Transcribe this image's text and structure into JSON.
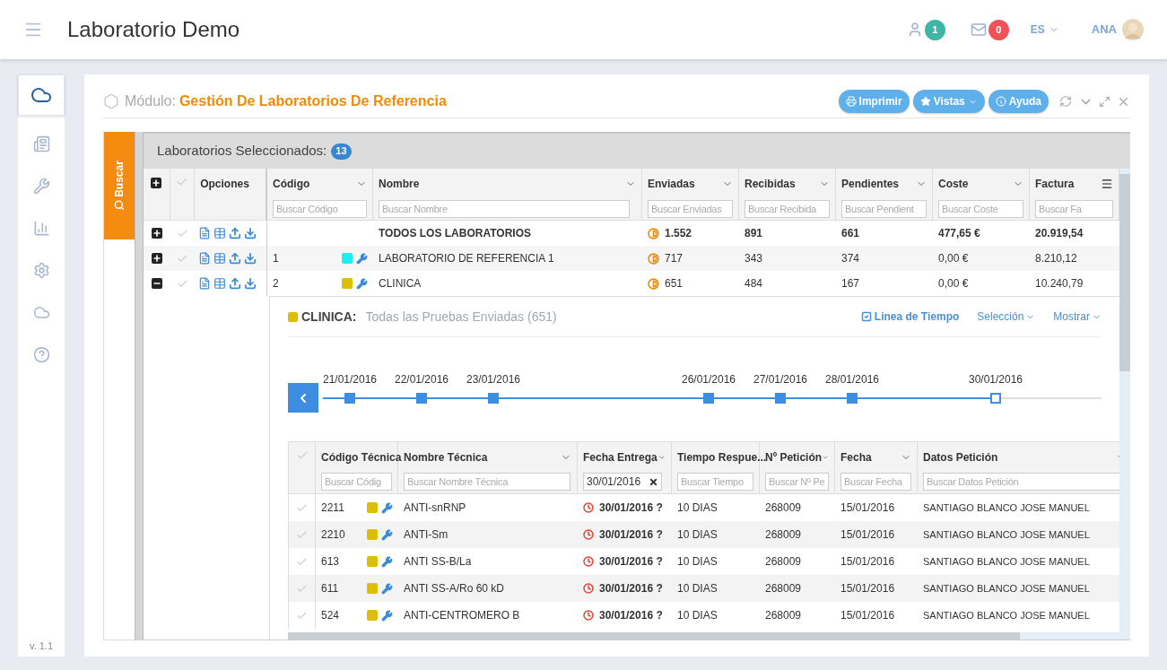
{
  "topbar": {
    "app_title": "Laboratorio Demo",
    "users_badge": "1",
    "messages_badge": "0",
    "language": "ES",
    "user": "ANA"
  },
  "sidebar": {
    "items": [
      {
        "selected": true
      },
      {
        "selected": false
      },
      {
        "selected": false
      },
      {
        "selected": false
      },
      {
        "selected": false
      },
      {
        "selected": false
      },
      {
        "selected": false
      }
    ],
    "version": "v. 1.1"
  },
  "module": {
    "label": "Módulo:",
    "title": "Gestión De Laboratorios De Referencia",
    "buttons": [
      "Imprimir",
      "Vistas",
      "Ayuda"
    ]
  },
  "search_tab": "Buscar",
  "labs": {
    "title": "Laboratorios Seleccionados:",
    "count": "13",
    "columns": [
      {
        "label": "Opciones"
      },
      {
        "label": "Código",
        "placeholder": "Buscar Código"
      },
      {
        "label": "Nombre",
        "placeholder": "Buscar Nombre"
      },
      {
        "label": "Enviadas",
        "placeholder": "Buscar Enviadas"
      },
      {
        "label": "Recibidas",
        "placeholder": "Buscar Recibida"
      },
      {
        "label": "Pendientes",
        "placeholder": "Buscar Pendient"
      },
      {
        "label": "Coste",
        "placeholder": "Buscar Coste"
      },
      {
        "label": "Factura",
        "placeholder": "Buscar Fa"
      }
    ],
    "rows": [
      {
        "kind": "total",
        "expanded": false,
        "code": "",
        "name": "TODOS LOS LABORATORIOS",
        "sent": "1.552",
        "received": "891",
        "pending": "661",
        "cost": "477,65 €",
        "invoice": "20.919,54"
      },
      {
        "kind": "lab",
        "expanded": false,
        "code": "1",
        "color": "#19f0f0",
        "name": "LABORATORIO DE REFERENCIA 1",
        "sent": "717",
        "received": "343",
        "pending": "374",
        "cost": "0,00 €",
        "invoice": "8.210,12"
      },
      {
        "kind": "lab",
        "expanded": true,
        "code": "2",
        "color": "#dcbf00",
        "name": "CLINICA",
        "sent": "651",
        "received": "484",
        "pending": "167",
        "cost": "0,00 €",
        "invoice": "10.240,79"
      }
    ]
  },
  "detail": {
    "color": "#dcbf00",
    "lab": "CLINICA:",
    "subtitle": "Todas las Pruebas Enviadas (651)",
    "timeline_toggle": {
      "label": "Linea de Tiempo",
      "checked": true
    },
    "menus": [
      "Selección",
      "Mostrar"
    ],
    "timeline": [
      {
        "date": "21/01/2016",
        "selected": false
      },
      {
        "date": "22/01/2016",
        "selected": false
      },
      {
        "date": "23/01/2016",
        "selected": false
      },
      {
        "date": "26/01/2016",
        "selected": false
      },
      {
        "date": "27/01/2016",
        "selected": false
      },
      {
        "date": "28/01/2016",
        "selected": false
      },
      {
        "date": "30/01/2016",
        "selected": true
      }
    ],
    "columns": [
      {
        "label": "Código Técnica",
        "placeholder": "Buscar Códig"
      },
      {
        "label": "Nombre Técnica",
        "placeholder": "Buscar Nombre Técnica"
      },
      {
        "label": "Fecha Entrega",
        "value": "30/01/2016"
      },
      {
        "label": "Tiempo Respue...",
        "placeholder": "Buscar Tiempo"
      },
      {
        "label": "Nº Petición",
        "placeholder": "Buscar Nº Pe"
      },
      {
        "label": "Fecha",
        "placeholder": "Buscar Fecha"
      },
      {
        "label": "Datos Petición",
        "placeholder": "Buscar Datos Petición"
      }
    ],
    "rows": [
      {
        "code": "2211",
        "color": "#dcbf00",
        "name": "ANTI-snRNP",
        "delivery": "30/01/2016 ?",
        "time": "10 DIAS",
        "request": "268009",
        "date": "15/01/2016",
        "patient": "SANTIAGO BLANCO JOSE MANUEL"
      },
      {
        "code": "2210",
        "color": "#dcbf00",
        "name": "ANTI-Sm",
        "delivery": "30/01/2016 ?",
        "time": "10 DIAS",
        "request": "268009",
        "date": "15/01/2016",
        "patient": "SANTIAGO BLANCO JOSE MANUEL"
      },
      {
        "code": "613",
        "color": "#dcbf00",
        "name": "ANTI SS-B/La",
        "delivery": "30/01/2016 ?",
        "time": "10 DIAS",
        "request": "268009",
        "date": "15/01/2016",
        "patient": "SANTIAGO BLANCO JOSE MANUEL"
      },
      {
        "code": "611",
        "color": "#dcbf00",
        "name": "ANTI SS-A/Ro 60 kD",
        "delivery": "30/01/2016 ?",
        "time": "10 DIAS",
        "request": "268009",
        "date": "15/01/2016",
        "patient": "SANTIAGO BLANCO JOSE MANUEL"
      },
      {
        "code": "524",
        "color": "#dcbf00",
        "name": "ANTI-CENTROMERO B",
        "delivery": "30/01/2016 ?",
        "time": "10 DIAS",
        "request": "268009",
        "date": "15/01/2016",
        "patient": "SANTIAGO BLANCO JOSE MANUEL"
      }
    ]
  }
}
